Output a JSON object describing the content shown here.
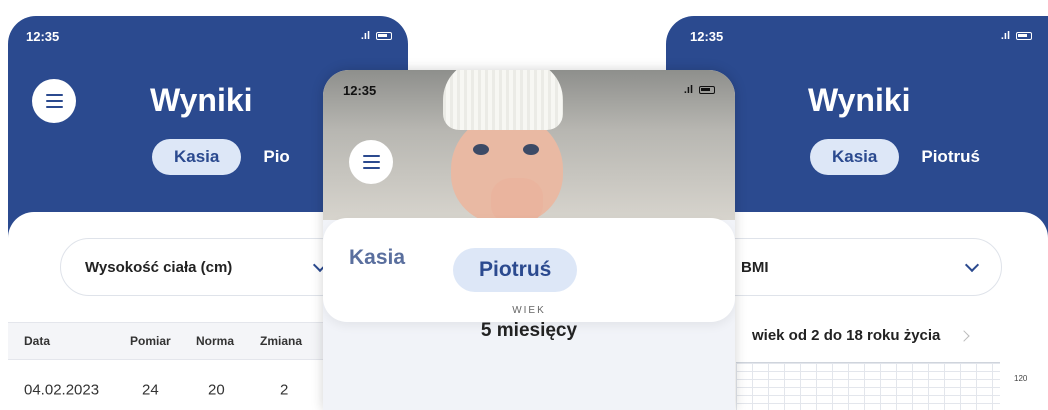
{
  "left_phone": {
    "time": "12:35",
    "title": "Wyniki",
    "tabs": [
      "Kasia",
      "Pio"
    ],
    "measure_select": "Wysokość ciała (cm)",
    "table": {
      "headers": [
        "Data",
        "Pomiar",
        "Norma",
        "Zmiana"
      ],
      "rows": [
        [
          "04.02.2023",
          "24",
          "20",
          "2"
        ]
      ]
    }
  },
  "middle_phone": {
    "time": "12:35",
    "tabs": [
      "Kasia",
      "Piotruś"
    ],
    "age_label": "WIEK",
    "age_value": "5 miesięcy"
  },
  "right_phone": {
    "time": "12:35",
    "title": "Wyniki",
    "tabs": [
      "Kasia",
      "Piotruś"
    ],
    "measure_select": "BMI",
    "range_label": "wiek od 2 do 18 roku życia",
    "axis_tick": "120"
  },
  "colors": {
    "brand_blue": "#2b4a8f",
    "active_tab_bg": "#dde7f7"
  },
  "icons": [
    "menu-icon",
    "signal-icon",
    "battery-icon",
    "chevron-down-icon",
    "chevron-right-icon"
  ]
}
